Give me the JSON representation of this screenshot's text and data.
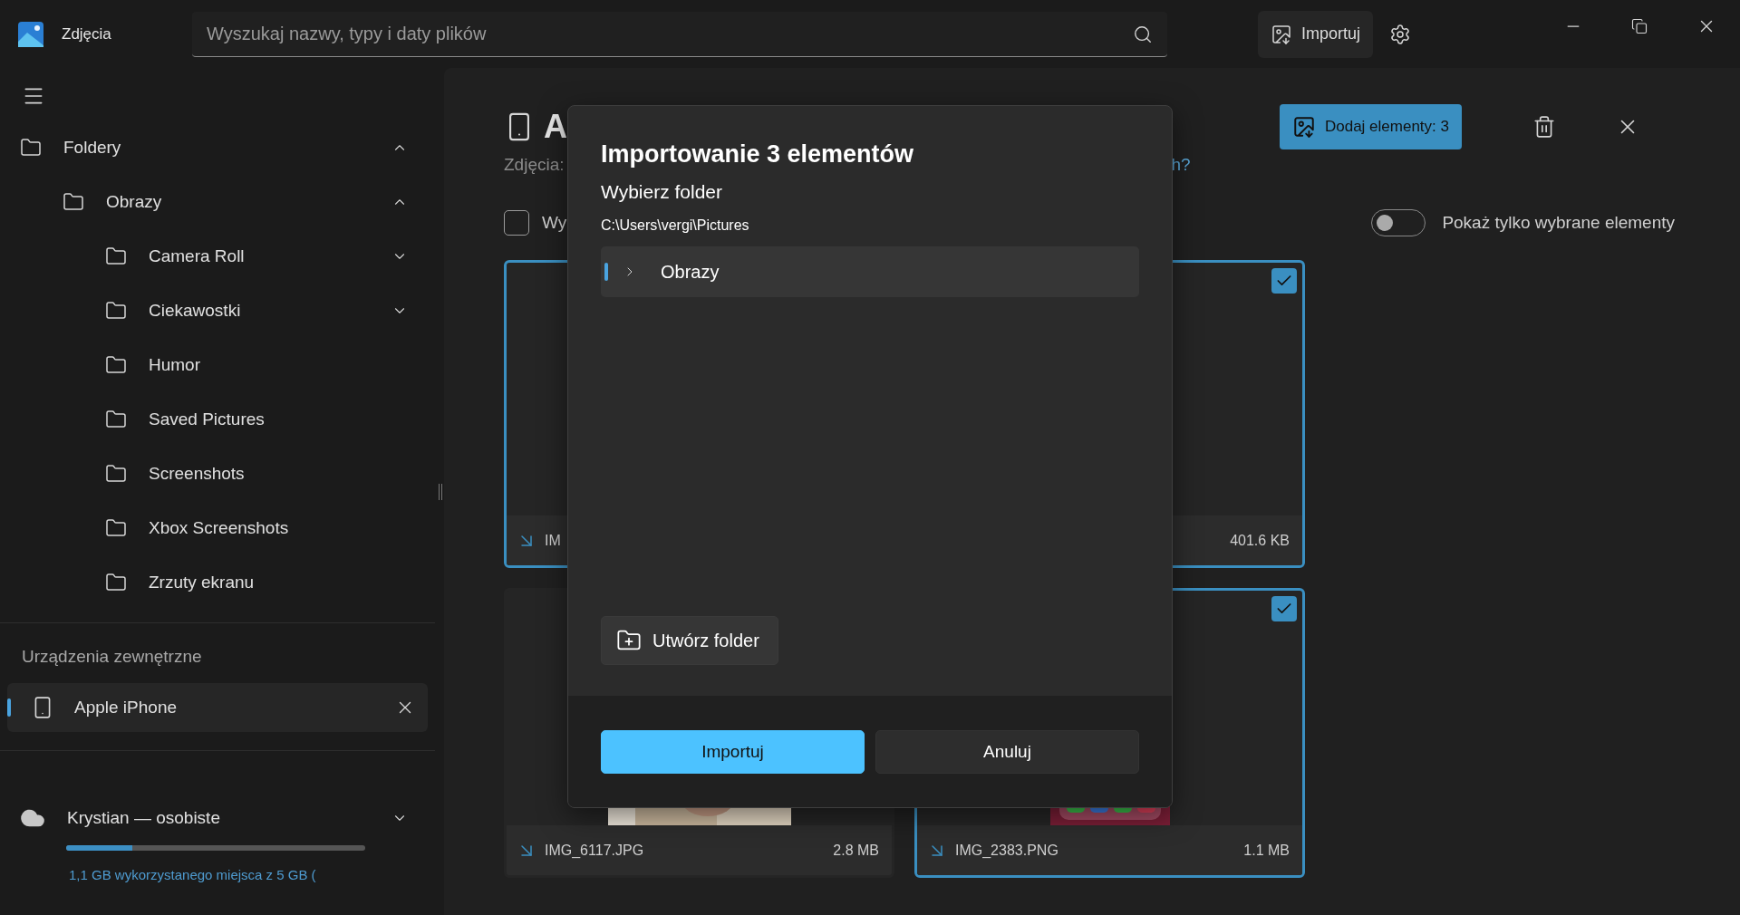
{
  "window": {
    "title": "Zdjęcia"
  },
  "search": {
    "placeholder": "Wyszukaj nazwy, typy i daty plików"
  },
  "toolbar": {
    "import_label": "Importuj"
  },
  "sidebar": {
    "folders": [
      {
        "label": "Foldery",
        "kind": "group",
        "expanded": true,
        "children": [
          {
            "label": "Obrazy",
            "kind": "group",
            "expanded": true,
            "children": [
              {
                "label": "Camera Roll",
                "kind": "group",
                "expanded": false
              },
              {
                "label": "Ciekawostki",
                "kind": "group",
                "expanded": false
              },
              {
                "label": "Humor",
                "kind": "leaf"
              },
              {
                "label": "Saved Pictures",
                "kind": "leaf"
              },
              {
                "label": "Screenshots",
                "kind": "leaf"
              },
              {
                "label": "Xbox Screenshots",
                "kind": "leaf"
              },
              {
                "label": "Zrzuty ekranu",
                "kind": "leaf"
              }
            ]
          }
        ]
      }
    ],
    "devices_heading": "Urządzenia zewnętrzne",
    "devices": [
      {
        "label": "Apple iPhone",
        "selected": true
      }
    ],
    "account": {
      "label": "Krystian — osobiste",
      "expanded": false,
      "level": 0.22,
      "storage": "1,1 GB wykorzystanego miejsca z 5 GB ("
    }
  },
  "main": {
    "title": "A",
    "subtitle": "Zdjęcia:",
    "link": "h?",
    "select_all": {
      "label": "Wy",
      "checked": false
    },
    "add_button": "Dodaj elementy: 3",
    "filter_toggle": {
      "label": "Pokaż tylko wybrane elementy",
      "on": false
    },
    "cards": [
      {
        "name": "IM",
        "selected": true
      },
      {
        "size": "401.6 KB",
        "selected": true,
        "checkbox": true
      },
      {
        "name": "IMG_6117.JPG",
        "size": "2.8 MB",
        "selected": false
      },
      {
        "name": "IMG_2383.PNG",
        "size": "1.1 MB",
        "selected": true,
        "checkbox": true,
        "kind": "phone"
      }
    ]
  },
  "dialog": {
    "title": "Importowanie 3 elementów",
    "subtitle": "Wybierz folder",
    "path": "C:\\Users\\vergi\\Pictures",
    "tree": [
      {
        "label": "Obrazy",
        "selected": true,
        "expanded": false
      }
    ],
    "create_folder": "Utwórz folder",
    "primary": "Importuj",
    "secondary": "Anuluj"
  }
}
